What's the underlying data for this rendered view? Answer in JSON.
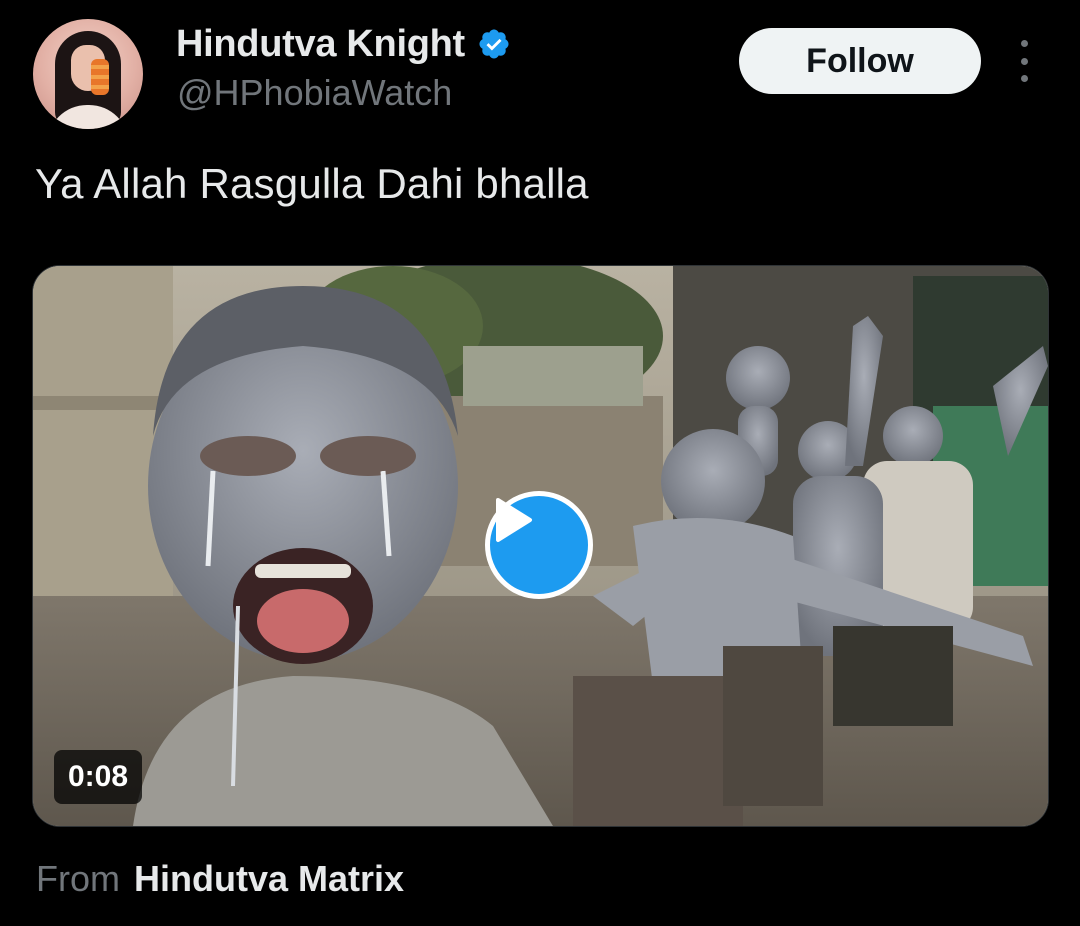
{
  "author": {
    "display_name": "Hindutva Knight",
    "handle": "@HPhobiaWatch",
    "verified": true
  },
  "actions": {
    "follow_label": "Follow",
    "more_icon": "more-vertical-icon"
  },
  "tweet": {
    "text": "Ya Allah Rasgulla Dahi bhalla"
  },
  "media": {
    "type": "video",
    "duration": "0:08",
    "play_icon": "play-icon"
  },
  "source": {
    "prefix": "From",
    "name": "Hindutva Matrix"
  },
  "colors": {
    "background": "#000000",
    "primary_text": "#e7e9ea",
    "secondary_text": "#71767b",
    "accent": "#1d9bf0",
    "follow_bg": "#eff3f4"
  }
}
